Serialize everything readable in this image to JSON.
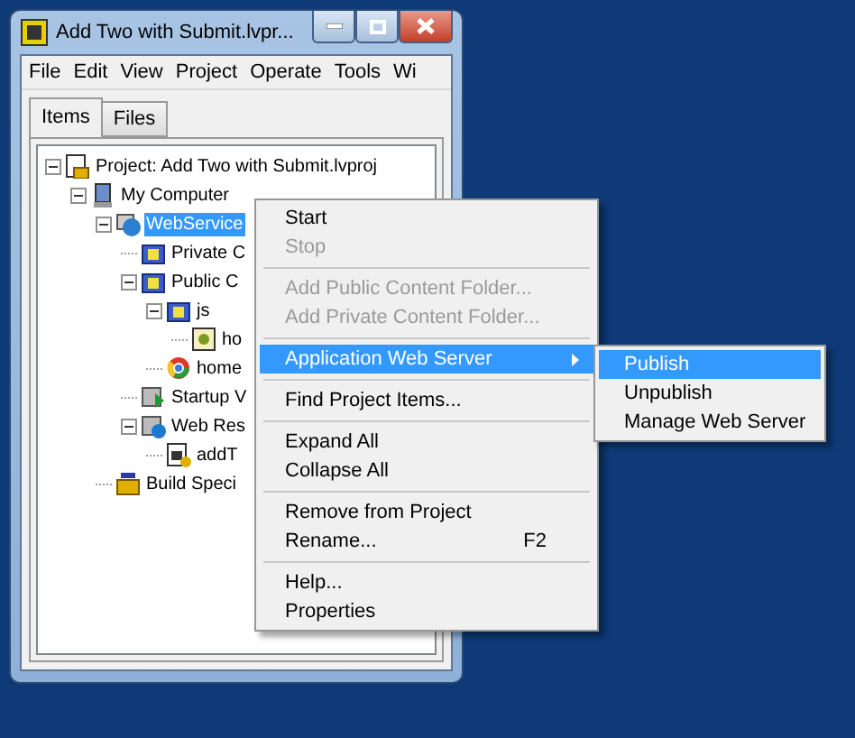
{
  "window": {
    "title": "Add Two with Submit.lvpr..."
  },
  "menu_bar": [
    "File",
    "Edit",
    "View",
    "Project",
    "Operate",
    "Tools",
    "Wi"
  ],
  "tabs": [
    {
      "label": "Items",
      "selected": true
    },
    {
      "label": "Files",
      "selected": false
    }
  ],
  "tree": [
    {
      "label": "Project: Add Two with Submit.lvproj",
      "kind": "project",
      "expanded": true,
      "selected": false,
      "children": [
        {
          "label": "My Computer",
          "kind": "computer",
          "expanded": true,
          "selected": false,
          "children": [
            {
              "label": "WebService",
              "kind": "webservice",
              "expanded": true,
              "selected": true,
              "children": [
                {
                  "label": "Private C",
                  "kind": "folder",
                  "selected": false
                },
                {
                  "label": "Public C",
                  "kind": "folder",
                  "expanded": true,
                  "selected": false,
                  "children": [
                    {
                      "label": "js",
                      "kind": "folder",
                      "expanded": true,
                      "selected": false,
                      "children": [
                        {
                          "label": "ho",
                          "kind": "script",
                          "selected": false
                        }
                      ]
                    },
                    {
                      "label": "home",
                      "kind": "browser",
                      "selected": false
                    }
                  ]
                },
                {
                  "label": "Startup V",
                  "kind": "startup",
                  "selected": false
                },
                {
                  "label": "Web Res",
                  "kind": "resource",
                  "expanded": true,
                  "selected": false,
                  "children": [
                    {
                      "label": "addT",
                      "kind": "vi",
                      "selected": false
                    }
                  ]
                }
              ]
            },
            {
              "label": "Build Speci",
              "kind": "build",
              "selected": false
            }
          ]
        }
      ]
    }
  ],
  "context_menu": [
    {
      "kind": "item",
      "label": "Start",
      "disabled": false,
      "selected": false
    },
    {
      "kind": "item",
      "label": "Stop",
      "disabled": true,
      "selected": false
    },
    {
      "kind": "separator"
    },
    {
      "kind": "item",
      "label": "Add Public Content Folder...",
      "disabled": true,
      "selected": false
    },
    {
      "kind": "item",
      "label": "Add Private Content Folder...",
      "disabled": true,
      "selected": false
    },
    {
      "kind": "separator"
    },
    {
      "kind": "submenu",
      "label": "Application Web Server",
      "disabled": false,
      "selected": true
    },
    {
      "kind": "separator"
    },
    {
      "kind": "item",
      "label": "Find Project Items...",
      "disabled": false,
      "selected": false
    },
    {
      "kind": "separator"
    },
    {
      "kind": "item",
      "label": "Expand All",
      "disabled": false,
      "selected": false
    },
    {
      "kind": "item",
      "label": "Collapse All",
      "disabled": false,
      "selected": false
    },
    {
      "kind": "separator"
    },
    {
      "kind": "item",
      "label": "Remove from Project",
      "disabled": false,
      "selected": false
    },
    {
      "kind": "item",
      "label": "Rename...",
      "shortcut": "F2",
      "disabled": false,
      "selected": false
    },
    {
      "kind": "separator"
    },
    {
      "kind": "item",
      "label": "Help...",
      "disabled": false,
      "selected": false
    },
    {
      "kind": "item",
      "label": "Properties",
      "disabled": false,
      "selected": false
    }
  ],
  "submenu": [
    {
      "label": "Publish",
      "selected": true
    },
    {
      "label": "Unpublish",
      "selected": false
    },
    {
      "label": "Manage Web Server",
      "selected": false
    }
  ]
}
